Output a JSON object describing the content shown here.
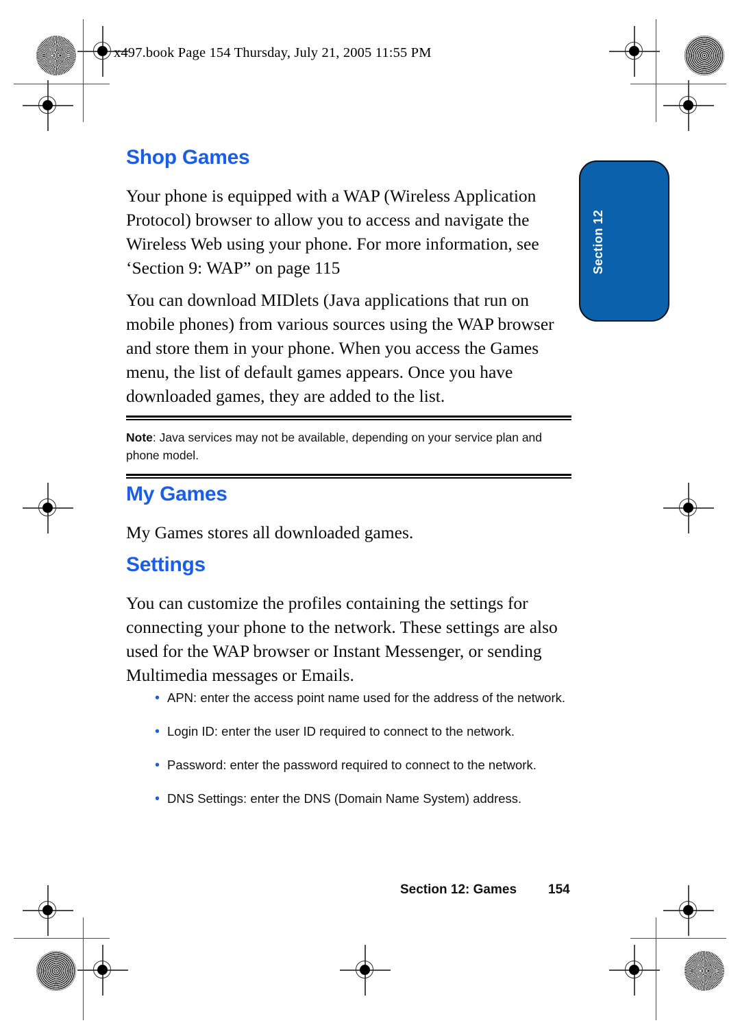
{
  "header": {
    "running_head": "x497.book  Page 154  Thursday, July 21, 2005  11:55 PM"
  },
  "side_tab": {
    "label": "Section 12",
    "color": "#0b61ac"
  },
  "colors": {
    "heading_blue": "#1a5ee8",
    "tab_blue": "#0b61ac",
    "body_text": "#0a0a0a"
  },
  "sections": {
    "shop_games": {
      "heading": "Shop Games",
      "paragraph_1": "Your phone is equipped with a WAP (Wireless Application Protocol) browser to allow you to access and navigate the Wireless Web using your phone. For more information, see ‘Section 9: WAP” on page 115",
      "paragraph_2": "You can download MIDlets (Java applications that run on mobile phones) from various sources using the WAP browser and store them in your phone.  When you access the Games menu, the list of default games appears. Once you have downloaded games, they are added to the list."
    },
    "note": {
      "label": "Note",
      "separator": ":",
      "text": " Java services may not be available, depending on your service plan and phone model."
    },
    "my_games": {
      "heading": "My Games",
      "paragraph_1": "My Games stores all downloaded games."
    },
    "settings": {
      "heading": "Settings",
      "paragraph_1": "You can customize the profiles containing the settings for connecting your phone to the network. These settings are also used for the WAP browser or Instant Messenger, or sending Multimedia messages or Emails.",
      "bullets": [
        "APN: enter the access point name used for the address of the network.",
        "Login ID: enter the user ID required to connect to the network.",
        "Password: enter the password required to connect to the network.",
        "DNS Settings: enter the DNS (Domain Name System) address."
      ],
      "bullet_glyph": "•"
    }
  },
  "footer": {
    "section_label": "Section 12: Games",
    "page_number": "154"
  }
}
